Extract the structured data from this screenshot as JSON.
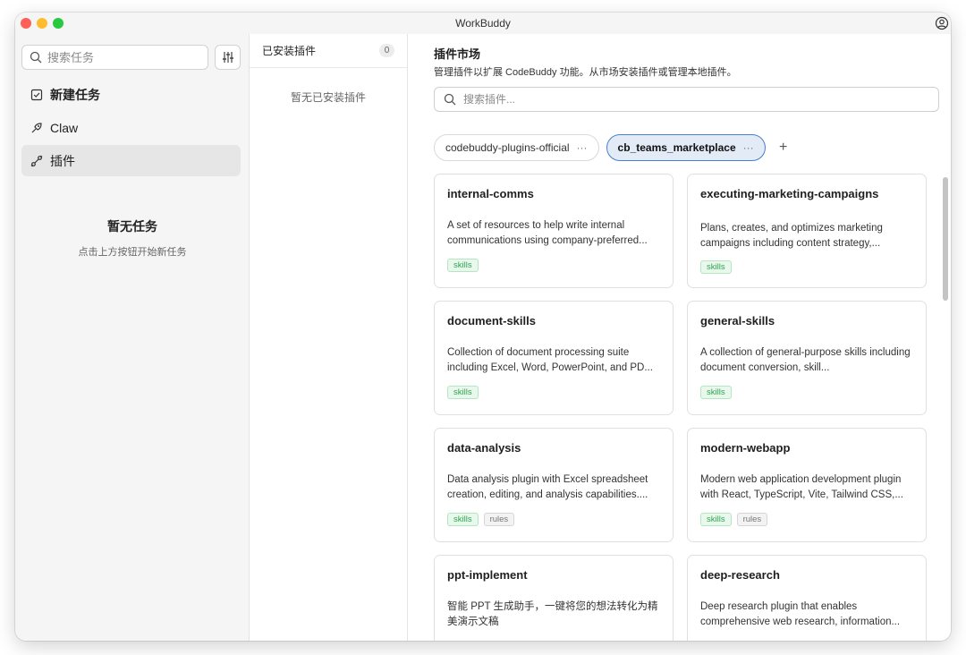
{
  "window": {
    "title": "WorkBuddy"
  },
  "sidebar": {
    "search_placeholder": "搜索任务",
    "items": [
      {
        "label": "新建任务",
        "icon": "new-task-icon"
      },
      {
        "label": "Claw",
        "icon": "claw-icon"
      },
      {
        "label": "插件",
        "icon": "plugin-icon",
        "active": true
      }
    ],
    "empty_title": "暂无任务",
    "empty_hint": "点击上方按钮开始新任务"
  },
  "installed": {
    "title": "已安装插件",
    "count": "0",
    "empty": "暂无已安装插件"
  },
  "market": {
    "title": "插件市场",
    "subtitle": "管理插件以扩展 CodeBuddy 功能。从市场安装插件或管理本地插件。",
    "search_placeholder": "搜索插件...",
    "sources": [
      {
        "label": "codebuddy-plugins-official",
        "more": "···",
        "active": false
      },
      {
        "label": "cb_teams_marketplace",
        "more": "···",
        "active": true
      }
    ],
    "add_label": "+",
    "plugins": [
      {
        "name": "internal-comms",
        "description": "A set of resources to help write internal communications using company-preferred...",
        "tags": [
          "skills"
        ]
      },
      {
        "name": "executing-marketing-campaigns",
        "description": "Plans, creates, and optimizes marketing campaigns including content strategy,...",
        "tags": [
          "skills"
        ]
      },
      {
        "name": "document-skills",
        "description": "Collection of document processing suite including Excel, Word, PowerPoint, and PD...",
        "tags": [
          "skills"
        ]
      },
      {
        "name": "general-skills",
        "description": "A collection of general-purpose skills including document conversion, skill...",
        "tags": [
          "skills"
        ]
      },
      {
        "name": "data-analysis",
        "description": "Data analysis plugin with Excel spreadsheet creation, editing, and analysis capabilities....",
        "tags": [
          "skills",
          "rules"
        ]
      },
      {
        "name": "modern-webapp",
        "description": "Modern web application development plugin with React, TypeScript, Vite, Tailwind CSS,...",
        "tags": [
          "skills",
          "rules"
        ]
      },
      {
        "name": "ppt-implement",
        "description": "智能 PPT 生成助手，一键将您的想法转化为精美演示文稿",
        "tags": []
      },
      {
        "name": "deep-research",
        "description": "Deep research plugin that enables comprehensive web research, information...",
        "tags": []
      }
    ]
  },
  "colors": {
    "accent_blue": "#4a7fc9",
    "skills_green": "#2fa44f",
    "traffic_red": "#fe5f57",
    "traffic_yellow": "#febc2e",
    "traffic_green": "#28c840"
  }
}
